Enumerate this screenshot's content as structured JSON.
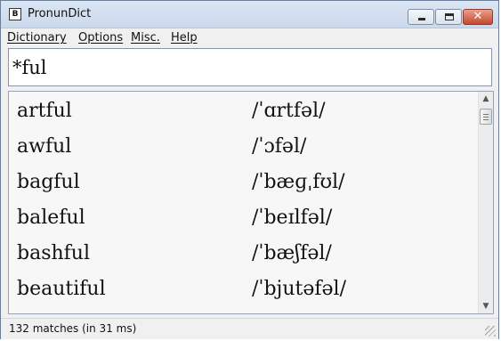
{
  "window": {
    "title": "PronunDict",
    "icon": "app-icon",
    "close_glyph": "✕"
  },
  "menu": {
    "items": [
      "Dictionary",
      "Options",
      "Misc.",
      "Help"
    ]
  },
  "search": {
    "value": "*ful"
  },
  "results": [
    {
      "word": "artful",
      "pronunciation": "/ˈɑrtfəl/"
    },
    {
      "word": "awful",
      "pronunciation": "/ˈɔfəl/"
    },
    {
      "word": "bagful",
      "pronunciation": "/ˈbæɡˌfʊl/"
    },
    {
      "word": "baleful",
      "pronunciation": "/ˈbeɪlfəl/"
    },
    {
      "word": "bashful",
      "pronunciation": "/ˈbæʃfəl/"
    },
    {
      "word": "beautiful",
      "pronunciation": "/ˈbjutəfəl/"
    }
  ],
  "scrollbar": {
    "up_arrow": "▲",
    "down_arrow": "▼"
  },
  "status": {
    "text": "132 matches (in 31 ms)"
  }
}
